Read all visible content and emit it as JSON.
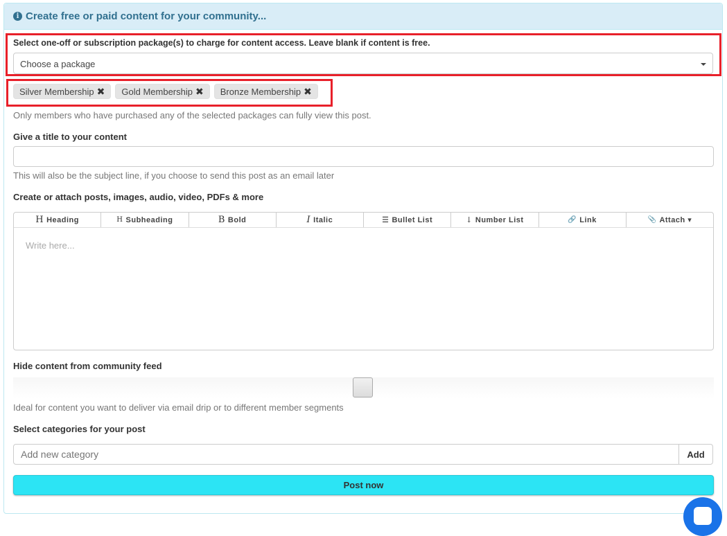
{
  "header": {
    "title": "Create free or paid content for your community...",
    "icon": "info-circle-icon"
  },
  "package": {
    "label": "Select one-off or subscription package(s) to charge for content access. Leave blank if content is free.",
    "placeholder": "Choose a package",
    "selected": [
      "Silver Membership",
      "Gold Membership",
      "Bronze Membership"
    ],
    "help": "Only members who have purchased any of the selected packages can fully view this post."
  },
  "title_field": {
    "label": "Give a title to your content",
    "value": "",
    "help": "This will also be the subject line, if you choose to send this post as an email later"
  },
  "editor": {
    "label": "Create or attach posts, images, audio, video, PDFs & more",
    "toolbar": [
      {
        "glyph": "H",
        "label": "Heading"
      },
      {
        "glyph": "H",
        "label": "Subheading"
      },
      {
        "glyph": "B",
        "label": "Bold"
      },
      {
        "glyph": "I",
        "label": "Italic"
      },
      {
        "glyph": "☰",
        "label": "Bullet List"
      },
      {
        "glyph": "↓",
        "label": "Number List"
      },
      {
        "glyph": "🔗",
        "label": "Link"
      },
      {
        "glyph": "📎",
        "label": "Attach ▾"
      }
    ],
    "placeholder": "Write here..."
  },
  "hide_feed": {
    "label": "Hide content from community feed",
    "help": "Ideal for content you want to deliver via email drip or to different member segments"
  },
  "categories": {
    "label": "Select categories for your post",
    "placeholder": "Add new category",
    "add_label": "Add"
  },
  "post_button": "Post now",
  "colors": {
    "heading_bg": "#d9edf7",
    "heading_text": "#31708f",
    "highlight": "#e8202a",
    "post_button": "#2ce4f4",
    "chat": "#1a73e8"
  }
}
